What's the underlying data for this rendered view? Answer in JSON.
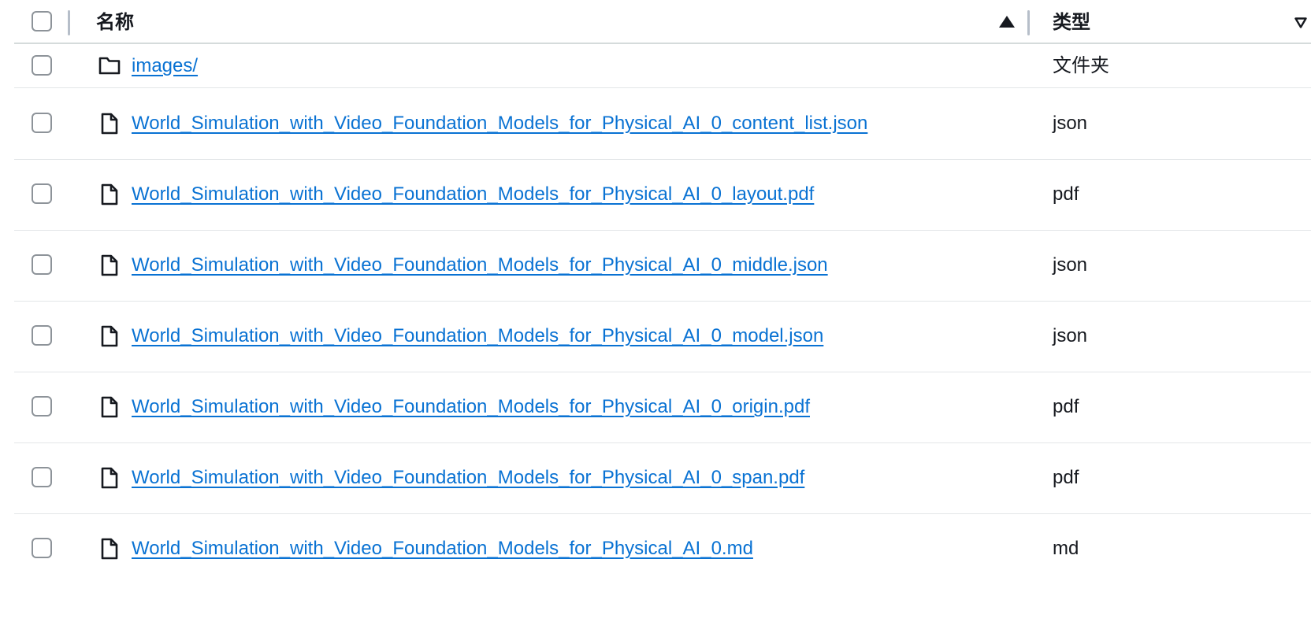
{
  "header": {
    "name_label": "名称",
    "type_label": "类型"
  },
  "rows": [
    {
      "name": "images/",
      "type": "文件夹",
      "icon": "folder-icon"
    },
    {
      "name": "World_Simulation_with_Video_Foundation_Models_for_Physical_AI_0_content_list.json",
      "type": "json",
      "icon": "file-icon"
    },
    {
      "name": "World_Simulation_with_Video_Foundation_Models_for_Physical_AI_0_layout.pdf",
      "type": "pdf",
      "icon": "file-icon"
    },
    {
      "name": "World_Simulation_with_Video_Foundation_Models_for_Physical_AI_0_middle.json",
      "type": "json",
      "icon": "file-icon"
    },
    {
      "name": "World_Simulation_with_Video_Foundation_Models_for_Physical_AI_0_model.json",
      "type": "json",
      "icon": "file-icon"
    },
    {
      "name": "World_Simulation_with_Video_Foundation_Models_for_Physical_AI_0_origin.pdf",
      "type": "pdf",
      "icon": "file-icon"
    },
    {
      "name": "World_Simulation_with_Video_Foundation_Models_for_Physical_AI_0_span.pdf",
      "type": "pdf",
      "icon": "file-icon"
    },
    {
      "name": "World_Simulation_with_Video_Foundation_Models_for_Physical_AI_0.md",
      "type": "md",
      "icon": "file-icon"
    }
  ],
  "colors": {
    "link": "#0972d3",
    "text": "#16191f",
    "divider": "#e3e6e8"
  }
}
